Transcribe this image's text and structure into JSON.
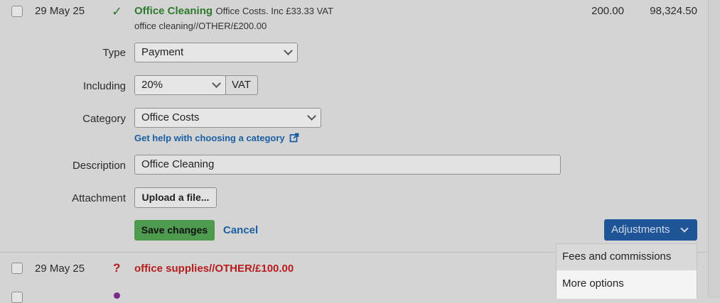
{
  "transaction1": {
    "date": "29 May 25",
    "title": "Office Cleaning",
    "summary": "Office Costs. Inc £33.33 VAT",
    "reference": "office cleaning//OTHER/£200.00",
    "amount": "200.00",
    "balance": "98,324.50",
    "status_symbol": "✓"
  },
  "form": {
    "type_label": "Type",
    "type_value": "Payment",
    "including_label": "Including",
    "vat_rate": "20%",
    "vat_button": "VAT",
    "category_label": "Category",
    "category_value": "Office Costs",
    "help_link": "Get help with choosing a category",
    "description_label": "Description",
    "description_value": "Office Cleaning",
    "attachment_label": "Attachment",
    "upload_button": "Upload a file...",
    "save_button": "Save changes",
    "cancel_link": "Cancel",
    "adjustments_button": "Adjustments"
  },
  "adjustments_menu": {
    "items": [
      "Fees and commissions",
      "More options"
    ]
  },
  "transaction2": {
    "date": "29 May 25",
    "status_symbol": "?",
    "reference": "office supplies//OTHER/£100.00"
  },
  "colors": {
    "green": "#2d7a2d",
    "red": "#b71c1c",
    "blue_link": "#1a5fa3",
    "save_green": "#4e9a4e",
    "adjust_blue": "#1e5596"
  }
}
